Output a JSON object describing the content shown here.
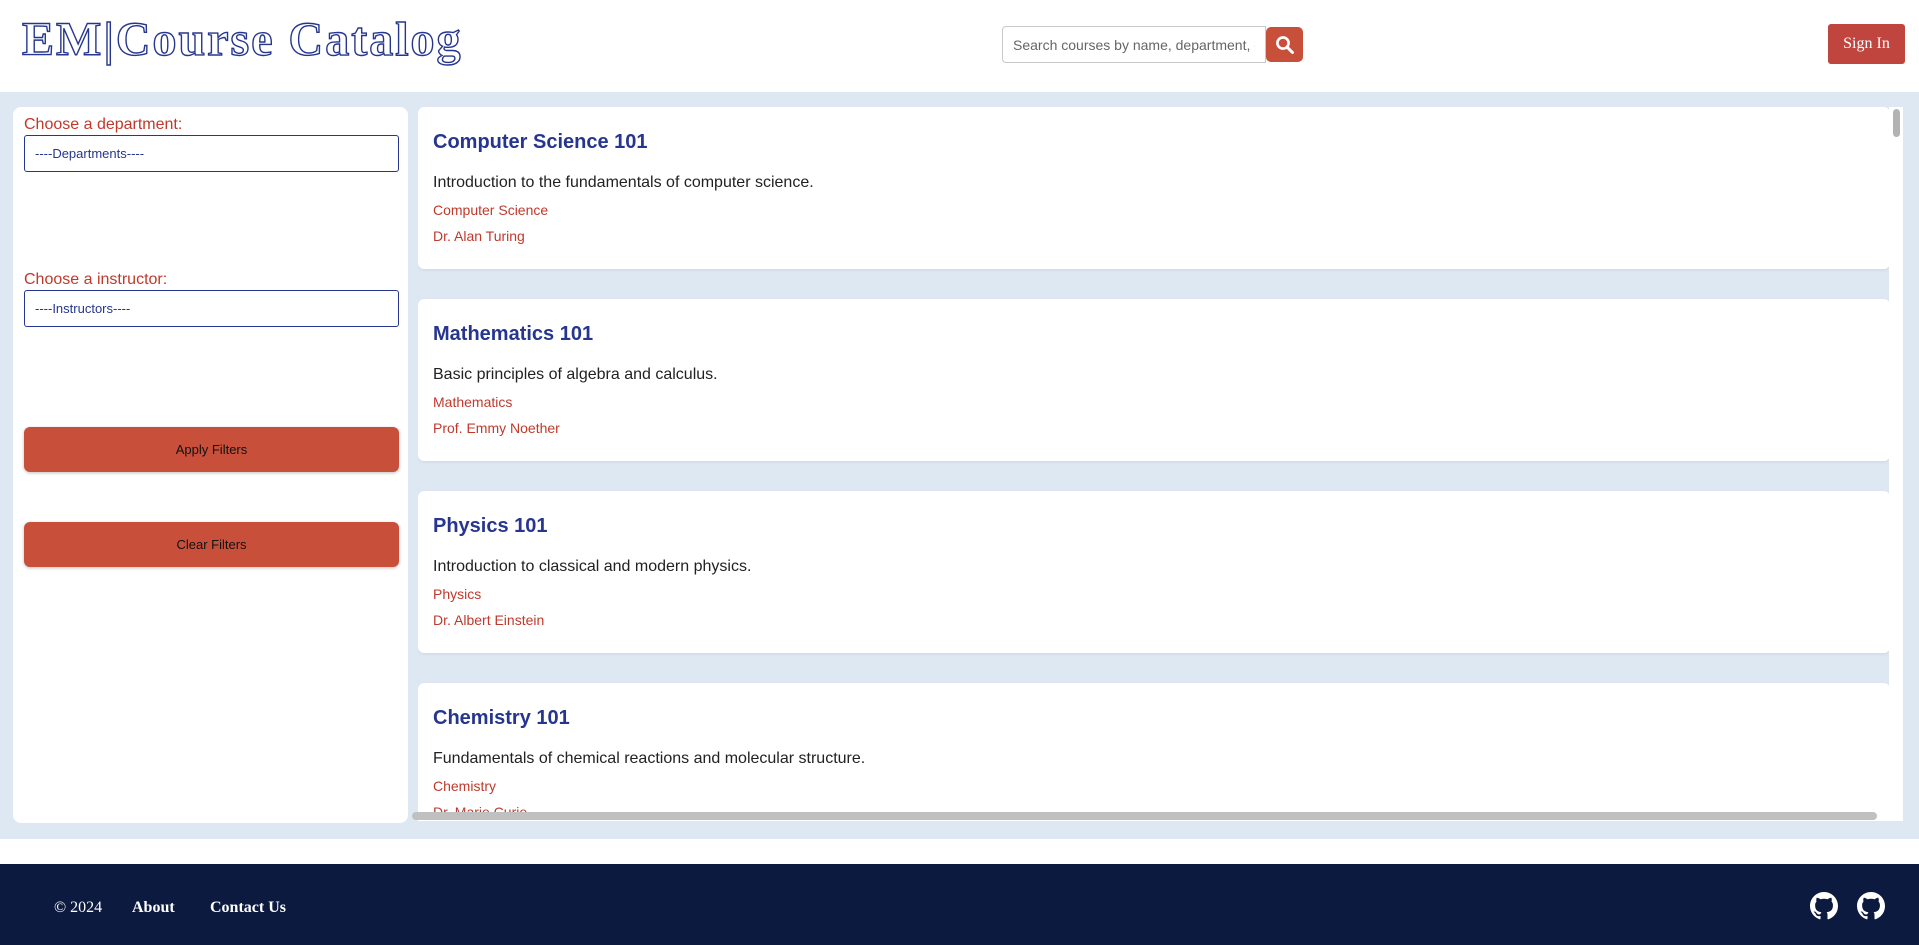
{
  "header": {
    "logo": "EM|Course Catalog",
    "search_placeholder": "Search courses by name, department, or instructor",
    "search_icon": "search-icon",
    "signin_label": "Sign In"
  },
  "sidebar": {
    "department_label": "Choose a department:",
    "department_selected": "----Departments----",
    "instructor_label": "Choose a instructor:",
    "instructor_selected": "----Instructors----",
    "apply_label": "Apply Filters",
    "clear_label": "Clear Filters"
  },
  "courses": [
    {
      "title": "Computer Science 101",
      "description": "Introduction to the fundamentals of computer science.",
      "department": "Computer Science",
      "instructor": "Dr. Alan Turing"
    },
    {
      "title": "Mathematics 101",
      "description": "Basic principles of algebra and calculus.",
      "department": "Mathematics",
      "instructor": "Prof. Emmy Noether"
    },
    {
      "title": "Physics 101",
      "description": "Introduction to classical and modern physics.",
      "department": "Physics",
      "instructor": "Dr. Albert Einstein"
    },
    {
      "title": "Chemistry 101",
      "description": "Fundamentals of chemical reactions and molecular structure.",
      "department": "Chemistry",
      "instructor": "Dr. Marie Curie"
    }
  ],
  "footer": {
    "copyright": "© 2024",
    "about": "About",
    "contact": "Contact Us",
    "icons": [
      "github-icon",
      "github-icon"
    ]
  },
  "colors": {
    "brand_blue": "#26368f",
    "accent_red": "#c8503a",
    "text_red": "#c0392b",
    "footer_bg": "#0d1a40",
    "main_bg": "#dde8f2"
  }
}
